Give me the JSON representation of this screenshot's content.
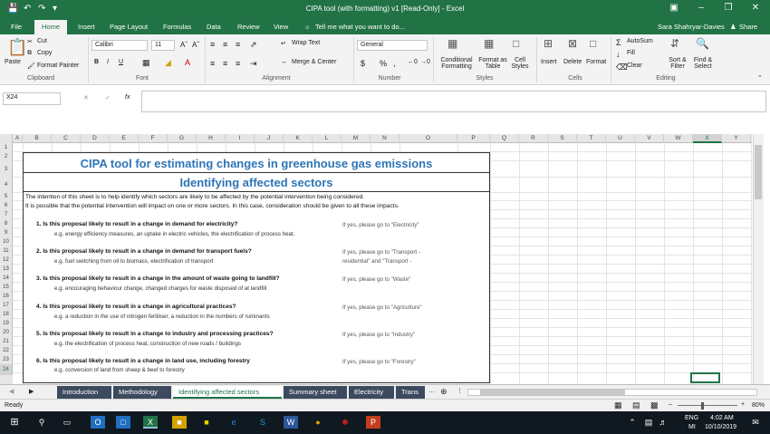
{
  "window": {
    "title": "CIPA tool (with formatting) v1  [Read-Only] - Excel",
    "user": "Sara Shahryar-Davies",
    "share": "Share"
  },
  "ribbon_tabs": [
    "File",
    "Home",
    "Insert",
    "Page Layout",
    "Formulas",
    "Data",
    "Review",
    "View"
  ],
  "tell_me": "Tell me what you want to do...",
  "clipboard": {
    "paste": "Paste",
    "cut": "Cut",
    "copy": "Copy",
    "format_painter": "Format Painter",
    "label": "Clipboard"
  },
  "font": {
    "name": "Calibri",
    "size": "11",
    "bold": "B",
    "italic": "I",
    "underline": "U",
    "label": "Font"
  },
  "alignment": {
    "wrap": "Wrap Text",
    "merge": "Merge & Center",
    "label": "Alignment"
  },
  "number": {
    "format": "General",
    "currency": "$",
    "percent": "%",
    "comma": ",",
    "label": "Number"
  },
  "styles": {
    "conditional": "Conditional Formatting",
    "format_table": "Format as Table",
    "cell_styles": "Cell Styles",
    "label": "Styles"
  },
  "cells": {
    "insert": "Insert",
    "delete": "Delete",
    "format": "Format",
    "label": "Cells"
  },
  "editing": {
    "autosum": "AutoSum",
    "fill": "Fill",
    "clear": "Clear",
    "sort": "Sort & Filter",
    "find": "Find & Select",
    "label": "Editing"
  },
  "name_box": "X24",
  "fx": "fx",
  "columns": [
    "A",
    "B",
    "C",
    "D",
    "E",
    "F",
    "G",
    "H",
    "I",
    "J",
    "K",
    "L",
    "M",
    "N",
    "O",
    "P",
    "Q",
    "R",
    "S",
    "T",
    "U",
    "V",
    "W",
    "X",
    "Y"
  ],
  "rows": [
    "1",
    "2",
    "3",
    "4",
    "5",
    "6",
    "7",
    "8",
    "9",
    "10",
    "11",
    "12",
    "13",
    "14",
    "15",
    "16",
    "17",
    "18",
    "19",
    "20",
    "21",
    "22",
    "23",
    "24"
  ],
  "sheet": {
    "title1": "CIPA tool for estimating changes in greenhouse gas emissions",
    "title2": "Identifying affected sectors",
    "intro1": "The intention of this sheet is to help identify which sectors are likely to be affected by the potential intervention being considered.",
    "intro2": "It is possible that the potential intervention will impact on one or more sectors.  In this case, consideration should be given to all these impacts.",
    "questions": [
      {
        "q": "1.  Is this proposal likely to result in a change in demand for electricity?",
        "eg": "e.g. energy efficiency measures, an uptake in electric vehicles, the electrification of process heat.",
        "go": "If yes, please go to \"Electricity\"",
        "go2": ""
      },
      {
        "q": "2.  Is this proposal likely to result in a change in demand for transport fuels?",
        "eg": "e.g. fuel switching from oil to biomass, electrification of transport",
        "go": "If yes, please go to \"Transport -",
        "go2": "residential\" and \"Transport -"
      },
      {
        "q": "3.  Is this proposal likely to result in a change in the amount of waste going to landfill?",
        "eg": "e.g. encouraging behaviour change, changed charges for waste disposed of at landfill",
        "go": "If yes, please go to \"Waste\"",
        "go2": ""
      },
      {
        "q": "4.   Is this proposal likely to result in a change in agricultural practices?",
        "eg": "e.g. a reduction in the use of nitrogen fertiliser, a reduction in the numbers of ruminants",
        "go": "If yes, please go to \"Agriculture\"",
        "go2": ""
      },
      {
        "q": "5.  Is this proposal likely to result in a change to industry and processing practices?",
        "eg": "e.g. the electrification of process heat, construction of new roads / buildings",
        "go": "If yes, please go to \"Industry\"",
        "go2": ""
      },
      {
        "q": "6.  Is this proposal likely to result in a change in land use, including forestry",
        "eg": "e.g. conversion of land from sheep & beef to forestry",
        "go": "If yes, please go to \"Forestry\"",
        "go2": ""
      }
    ]
  },
  "sheet_tabs": [
    "Introduction",
    "Methodology",
    "Identifying affected sectors",
    "Summary sheet",
    "Electricity",
    "Trans"
  ],
  "status": {
    "ready": "Ready",
    "zoom": "80%"
  },
  "taskbar": {
    "lang": "ENG",
    "lang2": "MI",
    "time": "4:02 AM",
    "date": "10/10/2019"
  },
  "accent": "#217346",
  "title_color": "#2e75b6"
}
